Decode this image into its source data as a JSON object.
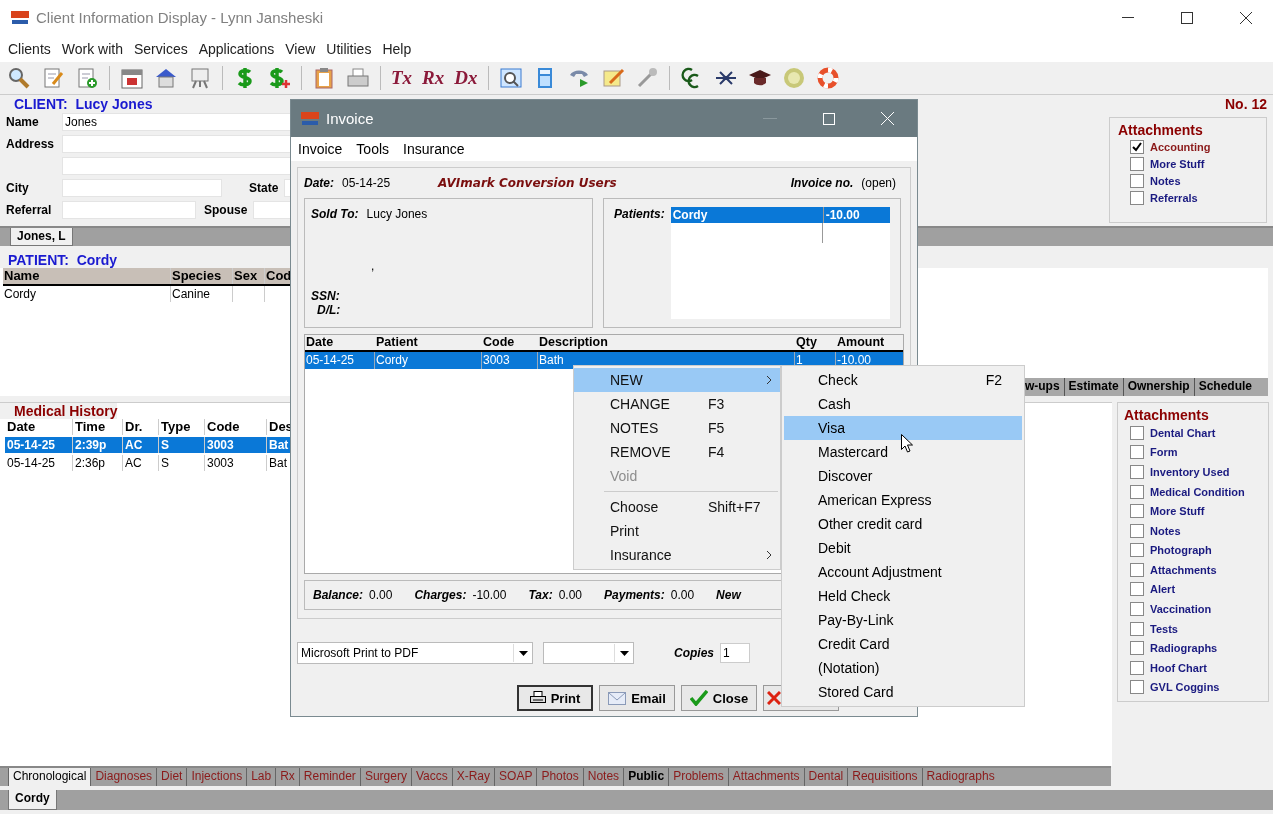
{
  "window": {
    "title": "Client Information Display - Lynn Jansheski"
  },
  "menu": [
    "Clients",
    "Work with",
    "Services",
    "Applications",
    "View",
    "Utilities",
    "Help"
  ],
  "toolbar_text_icons": [
    "Tx",
    "Rx",
    "Dx"
  ],
  "client": {
    "heading_label": "CLIENT:",
    "heading_name": "Lucy Jones",
    "number": "No. 12",
    "field_rows": [
      [
        {
          "label": "Name",
          "value": "Jones"
        }
      ],
      [
        {
          "label": "Address"
        }
      ],
      [
        {}
      ],
      [
        {
          "label": "City"
        },
        {
          "label": "State"
        }
      ],
      [
        {
          "label": "Referral"
        },
        {
          "label": "Spouse"
        }
      ]
    ]
  },
  "client_attachments": {
    "title": "Attachments",
    "items": [
      {
        "label": "Accounting",
        "checked": true
      },
      {
        "label": "More Stuff",
        "checked": false
      },
      {
        "label": "Notes",
        "checked": false
      },
      {
        "label": "Referrals",
        "checked": false
      }
    ]
  },
  "client_tabs": [
    {
      "label": "Jones, L",
      "selected": true
    }
  ],
  "patient": {
    "heading_label": "PATIENT:",
    "heading_name": "Cordy",
    "columns": [
      "Name",
      "Species",
      "Sex",
      "Cod"
    ],
    "rows": [
      {
        "name": "Cordy",
        "species": "Canine",
        "selected": false
      }
    ]
  },
  "patient_tabs": [
    {
      "label": "w-ups",
      "selected": false
    },
    {
      "label": "Estimate",
      "selected": false
    },
    {
      "label": "Ownership",
      "selected": false
    },
    {
      "label": "Schedule",
      "selected": false
    }
  ],
  "medical_history": {
    "title": "Medical History",
    "columns": [
      "Date",
      "Time",
      "Dr.",
      "Type",
      "Code",
      "Des"
    ],
    "rows": [
      {
        "cells": [
          "05-14-25",
          "2:39p",
          "AC",
          "S",
          "3003",
          "Bat"
        ],
        "selected": true
      },
      {
        "cells": [
          "05-14-25",
          "2:36p",
          "AC",
          "S",
          "3003",
          "Bat"
        ],
        "selected": false
      }
    ]
  },
  "patient_attachments": {
    "title": "Attachments",
    "items": [
      {
        "label": "Dental Chart",
        "checked": false
      },
      {
        "label": "Form",
        "checked": false
      },
      {
        "label": "Inventory Used",
        "checked": false
      },
      {
        "label": "Medical Condition",
        "checked": false
      },
      {
        "label": "More Stuff",
        "checked": false
      },
      {
        "label": "Notes",
        "checked": false
      },
      {
        "label": "Photograph",
        "checked": false
      },
      {
        "label": "Attachments",
        "checked": false
      },
      {
        "label": "Alert",
        "checked": false
      },
      {
        "label": "Vaccination",
        "checked": false
      },
      {
        "label": "Tests",
        "checked": false
      },
      {
        "label": "Radiographs",
        "checked": false
      },
      {
        "label": "Hoof Chart",
        "checked": false
      },
      {
        "label": "GVL Coggins",
        "checked": false
      }
    ]
  },
  "record_tabs": [
    {
      "label": "Chronological",
      "selected": true,
      "bold": false
    },
    {
      "label": "Diagnoses",
      "selected": false,
      "bold": false
    },
    {
      "label": "Diet",
      "selected": false,
      "bold": false
    },
    {
      "label": "Injections",
      "selected": false,
      "bold": false
    },
    {
      "label": "Lab",
      "selected": false,
      "bold": false
    },
    {
      "label": "Rx",
      "selected": false,
      "bold": false
    },
    {
      "label": "Reminder",
      "selected": false,
      "bold": false
    },
    {
      "label": "Surgery",
      "selected": false,
      "bold": false
    },
    {
      "label": "Vaccs",
      "selected": false,
      "bold": false
    },
    {
      "label": "X-Ray",
      "selected": false,
      "bold": false
    },
    {
      "label": "SOAP",
      "selected": false,
      "bold": false
    },
    {
      "label": "Photos",
      "selected": false,
      "bold": false
    },
    {
      "label": "Notes",
      "selected": false,
      "bold": false
    },
    {
      "label": "Public",
      "selected": false,
      "bold": true
    },
    {
      "label": "Problems",
      "selected": false,
      "bold": false
    },
    {
      "label": "Attachments",
      "selected": false,
      "bold": false
    },
    {
      "label": "Dental",
      "selected": false,
      "bold": false
    },
    {
      "label": "Requisitions",
      "selected": false,
      "bold": false
    },
    {
      "label": "Radiographs",
      "selected": false,
      "bold": false
    }
  ],
  "patient_strip_tabs": [
    {
      "label": "Cordy",
      "selected": true
    }
  ],
  "invoice": {
    "title": "Invoice",
    "menu": [
      "Invoice",
      "Tools",
      "Insurance"
    ],
    "date_label": "Date:",
    "date": "05-14-25",
    "practice": "AVImark Conversion Users",
    "invoice_no_label": "Invoice no.",
    "invoice_no": "(open)",
    "sold_to_label": "Sold To:",
    "sold_to": "Lucy Jones",
    "address_comma": ",",
    "ssn_label": "SSN:",
    "dl_label": "D/L:",
    "patients_label": "Patients:",
    "patients": [
      {
        "name": "Cordy",
        "amount": "-10.00",
        "selected": true
      }
    ],
    "columns": [
      "Date",
      "Patient",
      "Code",
      "Description",
      "Qty",
      "Amount"
    ],
    "rows": [
      {
        "cells": [
          "05-14-25",
          "Cordy",
          "3003",
          "Bath",
          "1",
          "-10.00"
        ],
        "selected": true
      }
    ],
    "totals": [
      {
        "label": "Balance:",
        "value": "0.00"
      },
      {
        "label": "Charges:",
        "value": "-10.00"
      },
      {
        "label": "Tax:",
        "value": "0.00"
      },
      {
        "label": "Payments:",
        "value": "0.00"
      },
      {
        "label": "New"
      }
    ],
    "printer": "Microsoft Print to PDF",
    "copies_label": "Copies",
    "copies": "1",
    "buttons": [
      {
        "label": "Print",
        "kind": "print"
      },
      {
        "label": "Email",
        "kind": "email"
      },
      {
        "label": "Close",
        "kind": "close"
      },
      {
        "kind": "cancel"
      }
    ]
  },
  "context_menu": {
    "items": [
      {
        "kind": "item",
        "label": "NEW",
        "submenu": true,
        "selected": true,
        "disabled": false
      },
      {
        "kind": "item",
        "label": "CHANGE",
        "shortcut": "F3",
        "submenu": false,
        "selected": false,
        "disabled": false
      },
      {
        "kind": "item",
        "label": "NOTES",
        "shortcut": "F5",
        "submenu": false,
        "selected": false,
        "disabled": false
      },
      {
        "kind": "item",
        "label": "REMOVE",
        "shortcut": "F4",
        "submenu": false,
        "selected": false,
        "disabled": false
      },
      {
        "kind": "item",
        "label": "Void",
        "submenu": false,
        "selected": false,
        "disabled": true
      },
      {
        "kind": "separator"
      },
      {
        "kind": "item",
        "label": "Choose",
        "shortcut": "Shift+F7",
        "submenu": false,
        "selected": false,
        "disabled": false
      },
      {
        "kind": "item",
        "label": "Print",
        "submenu": false,
        "selected": false,
        "disabled": false
      },
      {
        "kind": "item",
        "label": "Insurance",
        "submenu": true,
        "selected": false,
        "disabled": false
      }
    ]
  },
  "submenu": {
    "items": [
      {
        "label": "Check",
        "shortcut": "F2",
        "selected": false
      },
      {
        "label": "Cash",
        "selected": false
      },
      {
        "label": "Visa",
        "selected": true
      },
      {
        "label": "Mastercard",
        "selected": false
      },
      {
        "label": "Discover",
        "selected": false
      },
      {
        "label": "American Express",
        "selected": false
      },
      {
        "label": "Other credit card",
        "selected": false
      },
      {
        "label": "Debit",
        "selected": false
      },
      {
        "label": "Account Adjustment",
        "selected": false
      },
      {
        "label": "Held Check",
        "selected": false
      },
      {
        "label": "Pay-By-Link",
        "selected": false
      },
      {
        "label": "Credit Card",
        "selected": false
      },
      {
        "label": "(Notation)",
        "selected": false
      },
      {
        "label": "Stored Card",
        "selected": false
      }
    ]
  }
}
